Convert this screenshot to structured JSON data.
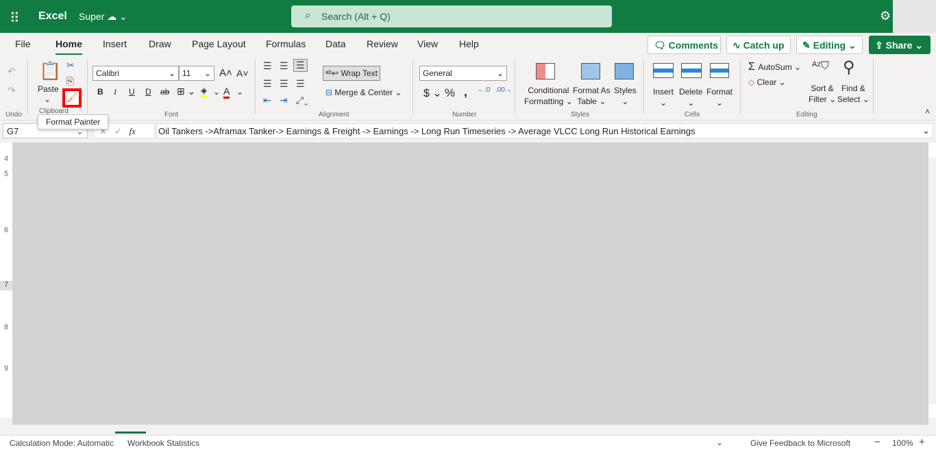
{
  "topbar": {
    "app": "Excel",
    "doc": "Super",
    "search_placeholder": "Search (Alt + Q)"
  },
  "tabs": [
    {
      "label": "File"
    },
    {
      "label": "Home",
      "active": true
    },
    {
      "label": "Insert"
    },
    {
      "label": "Draw"
    },
    {
      "label": "Page Layout"
    },
    {
      "label": "Formulas"
    },
    {
      "label": "Data"
    },
    {
      "label": "Review"
    },
    {
      "label": "View"
    },
    {
      "label": "Help"
    }
  ],
  "actions": {
    "comments": "Comments",
    "catchup": "Catch up",
    "editing": "Editing",
    "share": "Share"
  },
  "ribbon": {
    "undo_group": "Undo",
    "clipboard": {
      "paste": "Paste",
      "group": "Clipboard",
      "tooltip": "Format Painter"
    },
    "font": {
      "name": "Calibri",
      "size": "11",
      "group": "Font",
      "bold": "B",
      "italic": "I",
      "underline": "U",
      "dunderline": "D",
      "strike": "ab"
    },
    "alignment": {
      "wrap": "Wrap Text",
      "merge": "Merge & Center",
      "group": "Alignment"
    },
    "number": {
      "format": "General",
      "group": "Number",
      "currency": "$",
      "percent": "%",
      "comma": ","
    },
    "styles": {
      "conditional1": "Conditional",
      "conditional2": "Formatting",
      "table1": "Format As",
      "table2": "Table",
      "styles": "Styles",
      "group": "Styles"
    },
    "cells": {
      "insert": "Insert",
      "delete": "Delete",
      "format": "Format",
      "group": "Cells"
    },
    "editing": {
      "autosum": "AutoSum",
      "clear": "Clear",
      "sort1": "Sort &",
      "sort2": "Filter",
      "find1": "Find &",
      "find2": "Select",
      "group": "Editing"
    }
  },
  "formula_bar": {
    "cell": "G7",
    "fx": "fx",
    "value": "Oil Tankers ->Aframax Tanker-> Earnings & Freight -> Earnings ->  Long Run Timeseries -> Average VLCC Long Run Historical Earnings"
  },
  "rows": [
    "4",
    "5",
    "6",
    "7",
    "8",
    "9"
  ],
  "status": {
    "calc": "Calculation Mode: Automatic",
    "stats": "Workbook Statistics",
    "feedback": "Give Feedback to Microsoft",
    "zoom": "100%"
  },
  "colors": {
    "brand": "#107c41",
    "highlight": "#ff0000",
    "overlay": "#d3d3d3"
  }
}
